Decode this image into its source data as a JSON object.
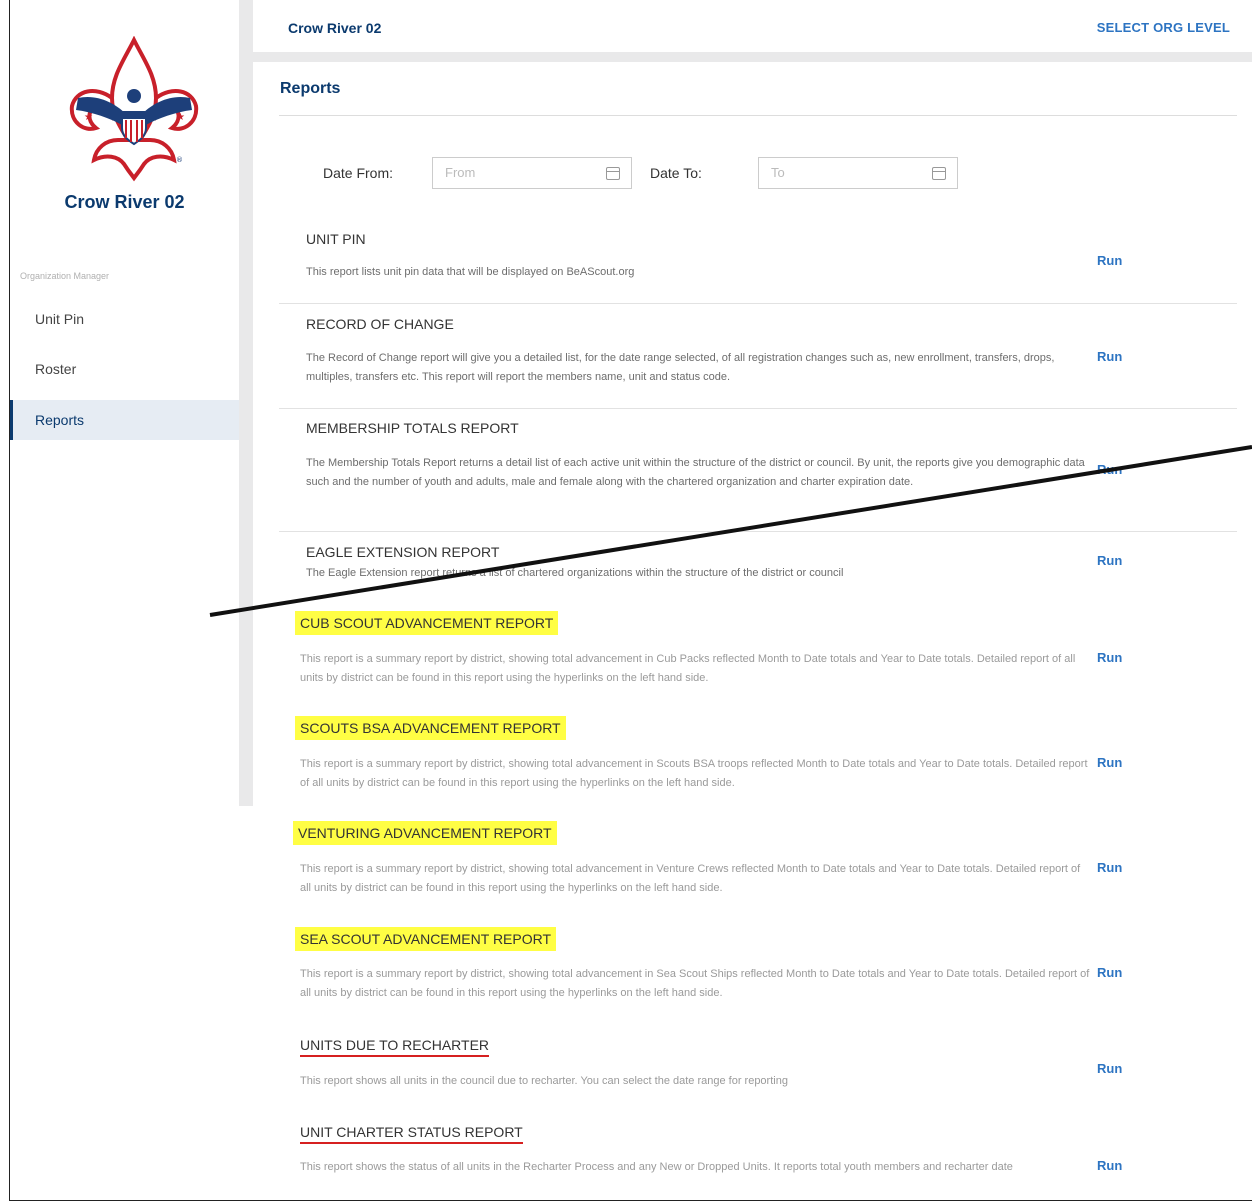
{
  "sidebar": {
    "org_name": "Crow River 02",
    "section_label": "Organization Manager",
    "items": [
      {
        "label": "Unit Pin"
      },
      {
        "label": "Roster"
      },
      {
        "label": "Reports"
      }
    ]
  },
  "header": {
    "title": "Crow River 02",
    "select_org_level": "SELECT ORG LEVEL"
  },
  "main": {
    "title": "Reports",
    "date_from_label": "Date From:",
    "date_from_placeholder": "From",
    "date_to_label": "Date To:",
    "date_to_placeholder": "To",
    "run_label": "Run",
    "reports": [
      {
        "title": "UNIT PIN",
        "desc": "This report lists unit pin data that will be displayed on BeAScout.org"
      },
      {
        "title": "RECORD OF CHANGE",
        "desc": "The Record of Change report will give you a detailed list, for the date range selected, of all registration changes such as, new enrollment, transfers, drops, multiples, transfers etc. This report will report the members name, unit and status code."
      },
      {
        "title": "MEMBERSHIP TOTALS REPORT",
        "desc": "The Membership Totals Report returns a detail list of each active unit within the structure of the district or council. By unit, the reports give you demographic data such and the number of youth and adults, male and female along with the chartered organization and charter expiration date."
      },
      {
        "title": "EAGLE EXTENSION REPORT",
        "desc": "The Eagle Extension report returns a list of chartered organizations within the structure of the district or council"
      },
      {
        "title": "CUB SCOUT ADVANCEMENT REPORT",
        "desc": "This report is a summary report by district, showing total advancement in Cub Packs reflected Month to Date totals and Year to Date totals. Detailed report of all units by district can be found in this report using the hyperlinks on the left hand side."
      },
      {
        "title": "SCOUTS BSA ADVANCEMENT REPORT",
        "desc": "This report is a summary report by district, showing total advancement in Scouts BSA troops reflected Month to Date totals and Year to Date totals. Detailed report of all units by district can be found in this report using the hyperlinks on the left hand side."
      },
      {
        "title": "VENTURING ADVANCEMENT REPORT",
        "desc": "This report is a summary report by district, showing total advancement in Venture Crews reflected Month to Date totals and Year to Date totals. Detailed report of all units by district can be found in this report using the hyperlinks on the left hand side."
      },
      {
        "title": "SEA SCOUT ADVANCEMENT REPORT",
        "desc": "This report is a summary report by district, showing total advancement in Sea Scout Ships reflected Month to Date totals and Year to Date totals. Detailed report of all units by district can be found in this report using the hyperlinks on the left hand side."
      },
      {
        "title": "UNITS DUE TO RECHARTER",
        "desc": "This report shows all units in the council due to recharter. You can select the date range for reporting"
      },
      {
        "title": "UNIT CHARTER STATUS REPORT",
        "desc": "This report shows the status of all units in the Recharter Process and any New or Dropped Units. It reports total youth members and recharter date"
      }
    ]
  },
  "colors": {
    "brand_navy": "#0b3a6e",
    "link_blue": "#2d74c2",
    "highlight_yellow": "#fffe44",
    "underline_red": "#d62020"
  }
}
